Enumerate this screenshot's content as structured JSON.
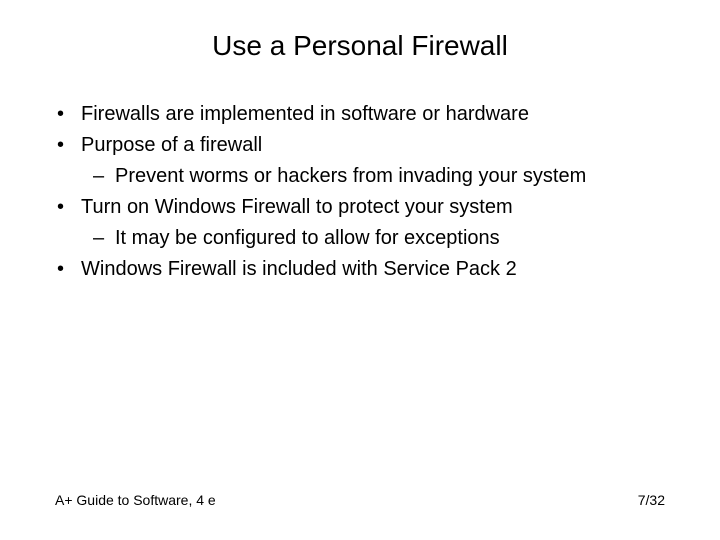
{
  "title": "Use a Personal Firewall",
  "bullets": [
    {
      "level": 1,
      "text": "Firewalls are implemented in software or hardware"
    },
    {
      "level": 1,
      "text": "Purpose of a firewall"
    },
    {
      "level": 2,
      "text": "Prevent worms or hackers from invading your system"
    },
    {
      "level": 1,
      "text": "Turn on Windows Firewall to protect your system"
    },
    {
      "level": 2,
      "text": "It may be configured to allow for exceptions"
    },
    {
      "level": 1,
      "text": "Windows Firewall is included with Service Pack 2"
    }
  ],
  "markers": {
    "l1": "•",
    "l2": "–"
  },
  "footer": {
    "left": "A+ Guide to Software, 4 e",
    "right": "7/32"
  }
}
